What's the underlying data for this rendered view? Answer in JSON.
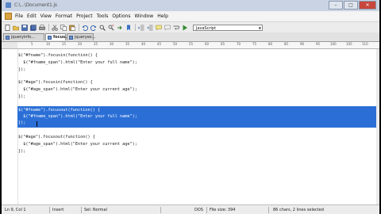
{
  "window": {
    "title": "C:\\...\\Document1.js",
    "min_label": "–",
    "max_label": "□",
    "close_label": "✕"
  },
  "menu": {
    "items": [
      "File",
      "Edit",
      "View",
      "Format",
      "Project",
      "Tools",
      "Options",
      "Window",
      "Help"
    ]
  },
  "toolbar": {
    "language_select": {
      "selected": "JavaScript"
    },
    "icons": [
      "new-icon",
      "open-icon",
      "save-icon",
      "save-all-icon",
      "print-icon",
      "cut-icon",
      "copy-icon",
      "paste-icon",
      "undo-icon",
      "redo-icon",
      "find-icon",
      "replace-icon",
      "goto-icon",
      "bookmark-icon",
      "indent-icon",
      "outdent-icon",
      "comment-icon",
      "uncomment-icon",
      "wrap-icon",
      "run-icon"
    ]
  },
  "tabs": [
    {
      "label": "jqueryinfo..."
    },
    {
      "label": "focus.js"
    },
    {
      "label": "jqueryex..."
    }
  ],
  "ruler": {
    "marks": [
      "5",
      "10",
      "15",
      "20",
      "25",
      "30",
      "35",
      "40",
      "45",
      "50",
      "55",
      "60",
      "65",
      "70",
      "75",
      "80",
      "85",
      "90",
      "95",
      "100",
      "105",
      "110"
    ]
  },
  "code": {
    "lines": [
      "$(\"#fname\").focusin(function() {",
      "  $(\"#fname_span\").html(\"Enter your full name\");",
      "});",
      "",
      "$(\"#age\").focusin(function() {",
      "  $(\"#age_span\").html(\"Enter your current age\");",
      "});",
      "",
      "$(\"#fname\").focusout(function() {",
      "  $(\"#fname_span\").html(\"Enter your full name\");",
      "});",
      "",
      "$(\"#age\").focusout(function() {",
      "  $(\"#age_span\").html(\"Enter your current age\");",
      "});"
    ]
  },
  "status": {
    "position": "Ln 9, Col 1",
    "mode": "Insert",
    "selection_mode": "Sel: Normal",
    "line_ending": "DOS",
    "file_size": "File size: 394",
    "selection_info": "86 chars, 2 lines selected"
  },
  "colors": {
    "selection": "#2b6fd6",
    "titlebar": "#c9d3e3",
    "close_button": "#c8463b"
  }
}
